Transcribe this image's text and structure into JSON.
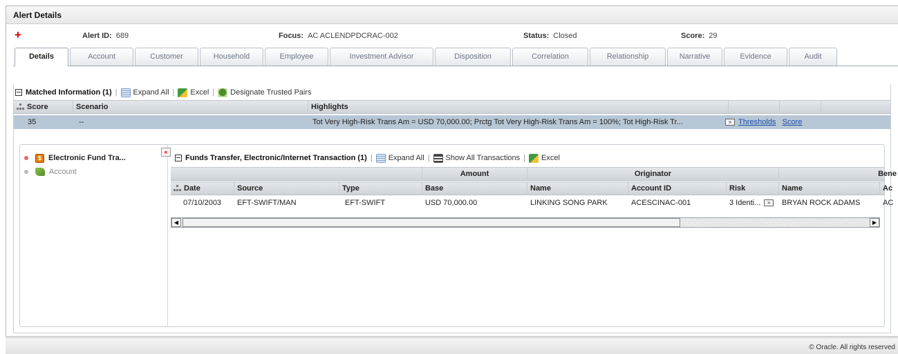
{
  "page": {
    "title": "Alert Details"
  },
  "alert": {
    "id_label": "Alert ID:",
    "id_value": "689",
    "focus_label": "Focus:",
    "focus_value": "AC ACLENDPDCRAC-002",
    "status_label": "Status:",
    "status_value": "Closed",
    "score_label": "Score:",
    "score_value": "29"
  },
  "tabs": [
    {
      "label": "Details",
      "active": true
    },
    {
      "label": "Account"
    },
    {
      "label": "Customer"
    },
    {
      "label": "Household"
    },
    {
      "label": "Employee"
    },
    {
      "label": "Investment Advisor"
    },
    {
      "label": "Disposition"
    },
    {
      "label": "Correlation"
    },
    {
      "label": "Relationship"
    },
    {
      "label": "Narrative"
    },
    {
      "label": "Evidence"
    },
    {
      "label": "Audit"
    }
  ],
  "matched": {
    "title": "Matched Information  (1)",
    "expand_all": "Expand All",
    "excel": "Excel",
    "designate": "Designate Trusted Pairs",
    "headers": {
      "score": "Score",
      "scenario": "Scenario",
      "highlights": "Highlights"
    },
    "row": {
      "score": "35",
      "scenario": "--",
      "highlights": "Tot Very High-Risk Trans Am = USD 70,000.00; Prctg Tot Very High-Risk Trans Am = 100%; Tot High-Risk Tr...",
      "thresholds": "Thresholds",
      "score_link": "Score"
    }
  },
  "nav": {
    "items": [
      {
        "label": "Electronic Fund Tra..."
      },
      {
        "label": "Account"
      }
    ]
  },
  "funds": {
    "title": "Funds Transfer, Electronic/Internet Transaction  (1)",
    "expand_all": "Expand All",
    "show_all": "Show All Transactions",
    "excel": "Excel",
    "group_headers": {
      "amount": "Amount",
      "originator": "Originator",
      "beneficiary": "Bene"
    },
    "headers": {
      "date": "Date",
      "source": "Source",
      "type": "Type",
      "base": "Base",
      "name": "Name",
      "account_id": "Account ID",
      "risk": "Risk",
      "ben_name": "Name",
      "ben_acct": "Ac"
    },
    "row": {
      "date": "07/10/2003",
      "source": "EFT-SWIFT/MAN",
      "type": "EFT-SWIFT",
      "base": "USD 70,000.00",
      "name": "LINKING SONG PARK",
      "account_id": "ACESCINAC-001",
      "risk": "3 Identi...",
      "ben_name": "BRYAN ROCK ADAMS",
      "ben_acct": "AC"
    }
  },
  "footer": {
    "copyright": "© Oracle. All rights reserved"
  },
  "colors": {
    "accent_red": "#d40000",
    "link_blue": "#1b4fa8",
    "row_selected": "#b8c7d6"
  }
}
